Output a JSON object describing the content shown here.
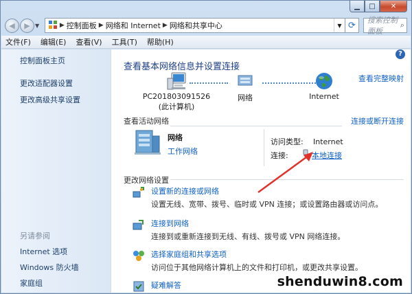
{
  "window": {
    "caption": {
      "minimize": "▁",
      "maximize": "□",
      "close": "✕"
    }
  },
  "address": {
    "crumbs": [
      "控制面板",
      "网络和 Internet",
      "网络和共享中心"
    ],
    "search_placeholder": "搜索控制面板"
  },
  "menu": [
    "文件(F)",
    "编辑(E)",
    "查看(V)",
    "工具(T)",
    "帮助(H)"
  ],
  "sidebar": {
    "home": "控制面板主页",
    "links": [
      "更改适配器设置",
      "更改高级共享设置"
    ],
    "see_also_heading": "另请参阅",
    "see_also": [
      "Internet 选项",
      "Windows 防火墙",
      "家庭组"
    ]
  },
  "main": {
    "title": "查看基本网络信息并设置连接",
    "full_map": "查看完整映射",
    "nodes": {
      "pc": "PC201803091526",
      "pc_sub": "(此计算机)",
      "network": "网络",
      "internet": "Internet"
    },
    "active_label": "查看活动网络",
    "connect_disconnect": "连接或断开连接",
    "active_net": {
      "name": "网络",
      "type": "工作网络"
    },
    "access": {
      "type_label": "访问类型:",
      "type_value": "Internet",
      "conn_label": "连接:",
      "conn_value": "本地连接"
    },
    "change_label": "更改网络设置",
    "tasks": [
      {
        "title": "设置新的连接或网络",
        "desc": "设置无线、宽带、拨号、临时或 VPN 连接；或设置路由器或访问点。"
      },
      {
        "title": "连接到网络",
        "desc": "连接到或重新连接到无线、有线、拨号或 VPN 网络连接。"
      },
      {
        "title": "选择家庭组和共享选项",
        "desc": "访问位于其他网络计算机上的文件和打印机，或更改共享设置。"
      },
      {
        "title": "疑难解答",
        "desc": ""
      }
    ]
  },
  "watermark": "shenduwin8.com",
  "colors": {
    "link": "#1062c6",
    "arrow": "#e0322a",
    "title": "#1c3f86"
  }
}
